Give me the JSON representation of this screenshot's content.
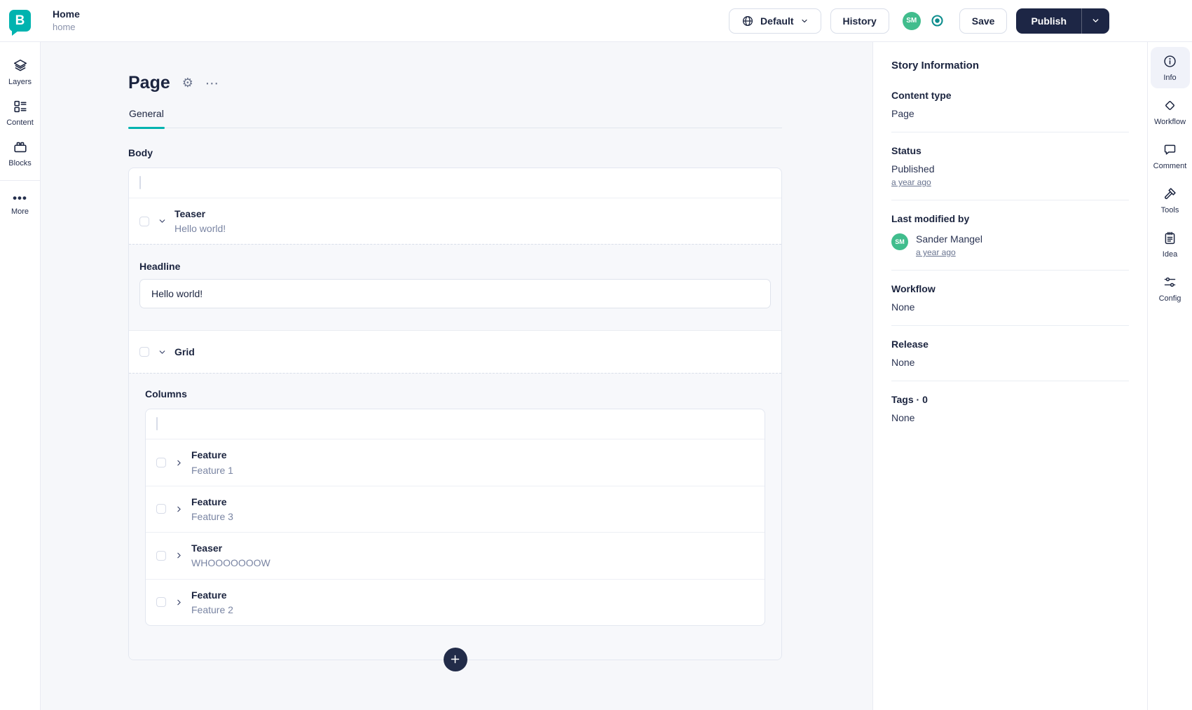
{
  "colors": {
    "accent_teal": "#00b3af",
    "navy": "#1d2645",
    "avatar_green": "#41bd8d",
    "target_teal": "#0d8d8d"
  },
  "topbar": {
    "logo_letter": "B",
    "story_title": "Home",
    "story_slug": "home",
    "language": "Default",
    "history": "History",
    "avatar_initials": "SM",
    "save": "Save",
    "publish": "Publish"
  },
  "left_rail": {
    "items": [
      {
        "label": "Layers"
      },
      {
        "label": "Content"
      },
      {
        "label": "Blocks"
      },
      {
        "label": "More"
      }
    ]
  },
  "editor": {
    "title": "Page",
    "tab_general": "General",
    "body_label": "Body",
    "teaser_row": {
      "type": "Teaser",
      "preview": "Hello world!"
    },
    "headline_label": "Headline",
    "headline_value": "Hello world!",
    "grid_row": {
      "type": "Grid"
    },
    "columns_label": "Columns",
    "column_rows": [
      {
        "type": "Feature",
        "preview": "Feature 1"
      },
      {
        "type": "Feature",
        "preview": "Feature 3"
      },
      {
        "type": "Teaser",
        "preview": "WHOOOOOOOW"
      },
      {
        "type": "Feature",
        "preview": "Feature 2"
      }
    ]
  },
  "story_info": {
    "title": "Story Information",
    "content_type_label": "Content type",
    "content_type_value": "Page",
    "status_label": "Status",
    "status_value": "Published",
    "status_time": "a year ago",
    "modified_label": "Last modified by",
    "modified_avatar": "SM",
    "modified_user": "Sander Mangel",
    "modified_time": "a year ago",
    "workflow_label": "Workflow",
    "workflow_value": "None",
    "release_label": "Release",
    "release_value": "None",
    "tags_label": "Tags · 0",
    "tags_value": "None"
  },
  "right_rail": {
    "items": [
      {
        "label": "Info"
      },
      {
        "label": "Workflow"
      },
      {
        "label": "Comment"
      },
      {
        "label": "Tools"
      },
      {
        "label": "Idea"
      },
      {
        "label": "Config"
      }
    ]
  }
}
